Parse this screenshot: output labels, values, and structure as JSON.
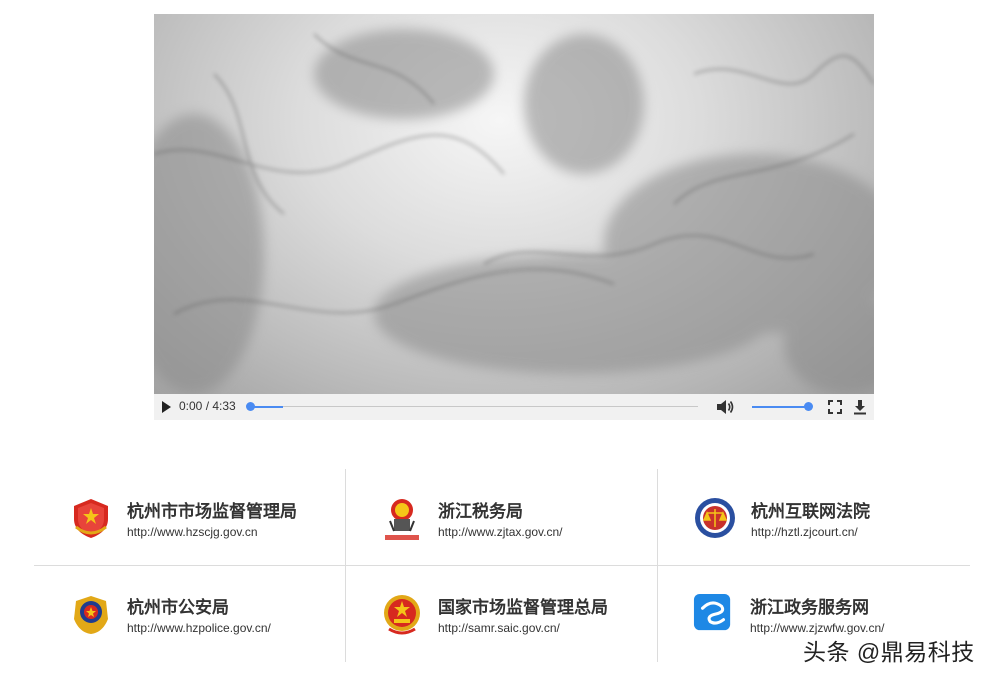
{
  "video": {
    "time_current": "0:00",
    "time_separator": " / ",
    "time_total": "4:33",
    "progress_fraction": 0.0,
    "volume_fraction": 1.0,
    "accent_color": "#4a8bf2",
    "icons": [
      "play-icon",
      "volume-icon",
      "fullscreen-icon",
      "download-icon"
    ]
  },
  "links": [
    {
      "name": "杭州市市场监督管理局",
      "url": "http://www.hzscjg.gov.cn",
      "icon": "market-regulation-emblem-icon"
    },
    {
      "name": "浙江税务局",
      "url": "http://www.zjtax.gov.cn/",
      "icon": "tax-emblem-icon"
    },
    {
      "name": "杭州互联网法院",
      "url": "http://hztl.zjcourt.cn/",
      "icon": "court-emblem-icon"
    },
    {
      "name": "杭州市公安局",
      "url": "http://www.hzpolice.gov.cn/",
      "icon": "police-emblem-icon"
    },
    {
      "name": "国家市场监督管理总局",
      "url": "http://samr.saic.gov.cn/",
      "icon": "national-emblem-icon"
    },
    {
      "name": "浙江政务服务网",
      "url": "http://www.zjzwfw.gov.cn/",
      "icon": "zjzwfw-logo-icon"
    }
  ],
  "watermark": "头条 @鼎易科技"
}
